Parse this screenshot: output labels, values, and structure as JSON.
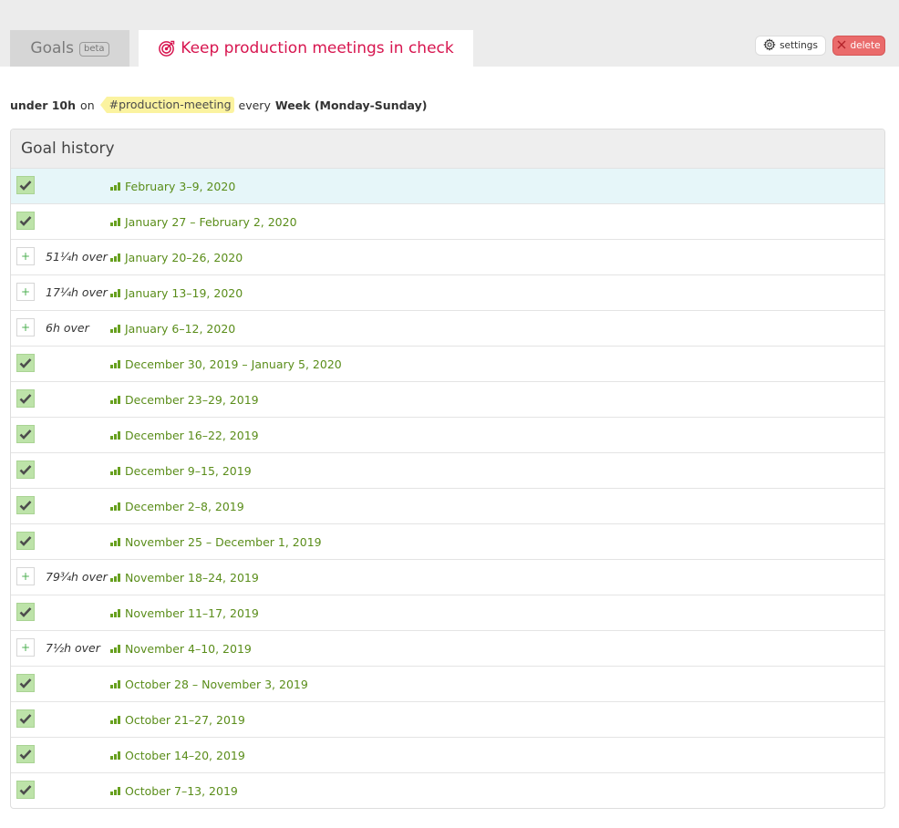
{
  "tabs": {
    "goals_label": "Goals",
    "goals_badge": "beta",
    "active_title": "Keep production meetings in check"
  },
  "actions": {
    "settings_label": "settings",
    "delete_label": "delete"
  },
  "summary": {
    "limit": "under 10h",
    "on_word": "on",
    "tag": "#production-meeting",
    "every_word": "every",
    "period": "Week (Monday-Sunday)"
  },
  "history": {
    "title": "Goal history",
    "rows": [
      {
        "status": "met",
        "over": "",
        "period": "February 3–9, 2020",
        "highlight": true
      },
      {
        "status": "met",
        "over": "",
        "period": "January 27 – February 2, 2020"
      },
      {
        "status": "missed",
        "over": "51¼h over",
        "period": "January 20–26, 2020"
      },
      {
        "status": "missed",
        "over": "17¼h over",
        "period": "January 13–19, 2020"
      },
      {
        "status": "missed",
        "over": "6h over",
        "period": "January 6–12, 2020"
      },
      {
        "status": "met",
        "over": "",
        "period": "December 30, 2019 – January 5, 2020"
      },
      {
        "status": "met",
        "over": "",
        "period": "December 23–29, 2019"
      },
      {
        "status": "met",
        "over": "",
        "period": "December 16–22, 2019"
      },
      {
        "status": "met",
        "over": "",
        "period": "December 9–15, 2019"
      },
      {
        "status": "met",
        "over": "",
        "period": "December 2–8, 2019"
      },
      {
        "status": "met",
        "over": "",
        "period": "November 25 – December 1, 2019"
      },
      {
        "status": "missed",
        "over": "79¾h over",
        "period": "November 18–24, 2019"
      },
      {
        "status": "met",
        "over": "",
        "period": "November 11–17, 2019"
      },
      {
        "status": "missed",
        "over": "7½h over",
        "period": "November 4–10, 2019"
      },
      {
        "status": "met",
        "over": "",
        "period": "October 28 – November 3, 2019"
      },
      {
        "status": "met",
        "over": "",
        "period": "October 21–27, 2019"
      },
      {
        "status": "met",
        "over": "",
        "period": "October 14–20, 2019"
      },
      {
        "status": "met",
        "over": "",
        "period": "October 7–13, 2019"
      }
    ]
  },
  "colors": {
    "accent_title": "#d7154f",
    "period_link": "#5a8d1a",
    "met_fill": "#bde3a9",
    "delete_button": "#ea6b6b",
    "tag_bg": "#fbf3a0"
  },
  "icons": {
    "active_tab": "target-icon",
    "settings": "gear-icon",
    "delete": "close-icon",
    "met": "checkmark-icon",
    "missed": "plus-icon",
    "period": "bar-chart-icon"
  }
}
